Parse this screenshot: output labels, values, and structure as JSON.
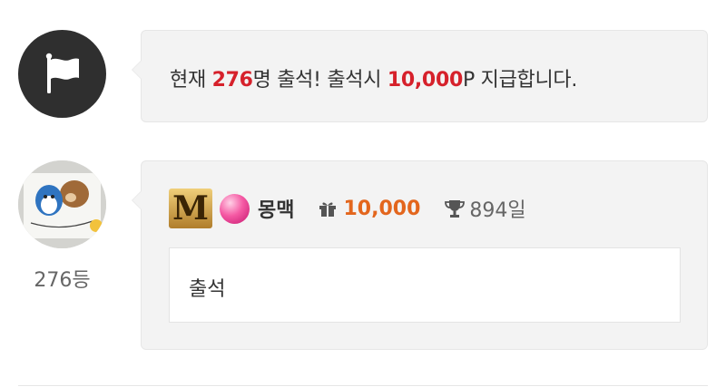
{
  "notice": {
    "prefix": "현재 ",
    "count": "276",
    "middle": "명 출석! 출석시 ",
    "reward": "10,000",
    "suffix": "P 지급합니다.",
    "icon": "flag-icon"
  },
  "entry": {
    "rank": "276등",
    "level_badge": "M",
    "nickname": "몽맥",
    "points": "10,000",
    "days": "894일",
    "comment": "출석",
    "icons": [
      "gift-icon",
      "trophy-icon",
      "gem-icon"
    ]
  },
  "colors": {
    "highlight_red": "#d6212b",
    "points_orange": "#e3661d",
    "bubble_bg": "#f3f3f3",
    "flag_circle": "#2f2f2f"
  }
}
